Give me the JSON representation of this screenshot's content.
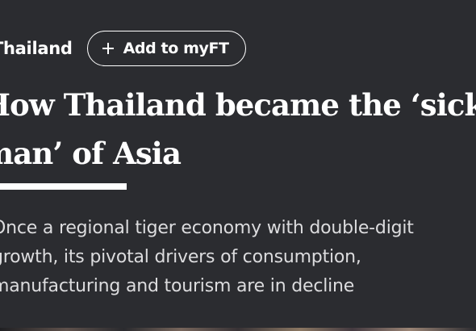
{
  "topic": {
    "label": "Thailand"
  },
  "follow": {
    "label": "Add to myFT"
  },
  "headline": {
    "lines": [
      "How Thailand became the ‘sick",
      "man’ of Asia"
    ]
  },
  "standfirst": {
    "lines": [
      "Once a regional tiger economy with double-digit",
      "growth, its pivotal drivers of consumption,",
      "manufacturing and tourism are in decline"
    ]
  },
  "colors": {
    "background": "#2b2c30",
    "text": "#ffffff",
    "standfirst_text": "#dcdcde"
  }
}
